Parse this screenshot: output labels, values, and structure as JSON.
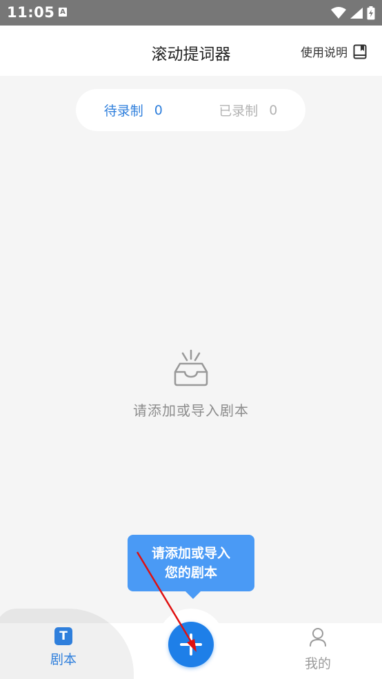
{
  "status_bar": {
    "time": "11:05",
    "notification_badge": "A",
    "icons": [
      "wifi-icon",
      "signal-icon",
      "battery-charging-icon"
    ]
  },
  "header": {
    "title": "滚动提词器",
    "help_label": "使用说明",
    "help_icon": "book-icon"
  },
  "tabs": [
    {
      "label": "待录制",
      "count": "0",
      "active": true
    },
    {
      "label": "已录制",
      "count": "0",
      "active": false
    }
  ],
  "empty_state": {
    "icon": "empty-inbox-icon",
    "text": "请添加或导入剧本"
  },
  "tooltip": {
    "line1": "请添加或导入",
    "line2": "您的剧本"
  },
  "bottom_nav": {
    "items": [
      {
        "label": "剧本",
        "icon": "script-icon",
        "icon_glyph": "T",
        "active": true
      },
      {
        "label": "我的",
        "icon": "person-icon",
        "active": false
      }
    ],
    "fab_icon": "plus-icon"
  },
  "colors": {
    "accent": "#2f7fdc",
    "fab": "#1e7fe8",
    "tooltip": "#4a9af5",
    "annotation": "#e01010"
  }
}
